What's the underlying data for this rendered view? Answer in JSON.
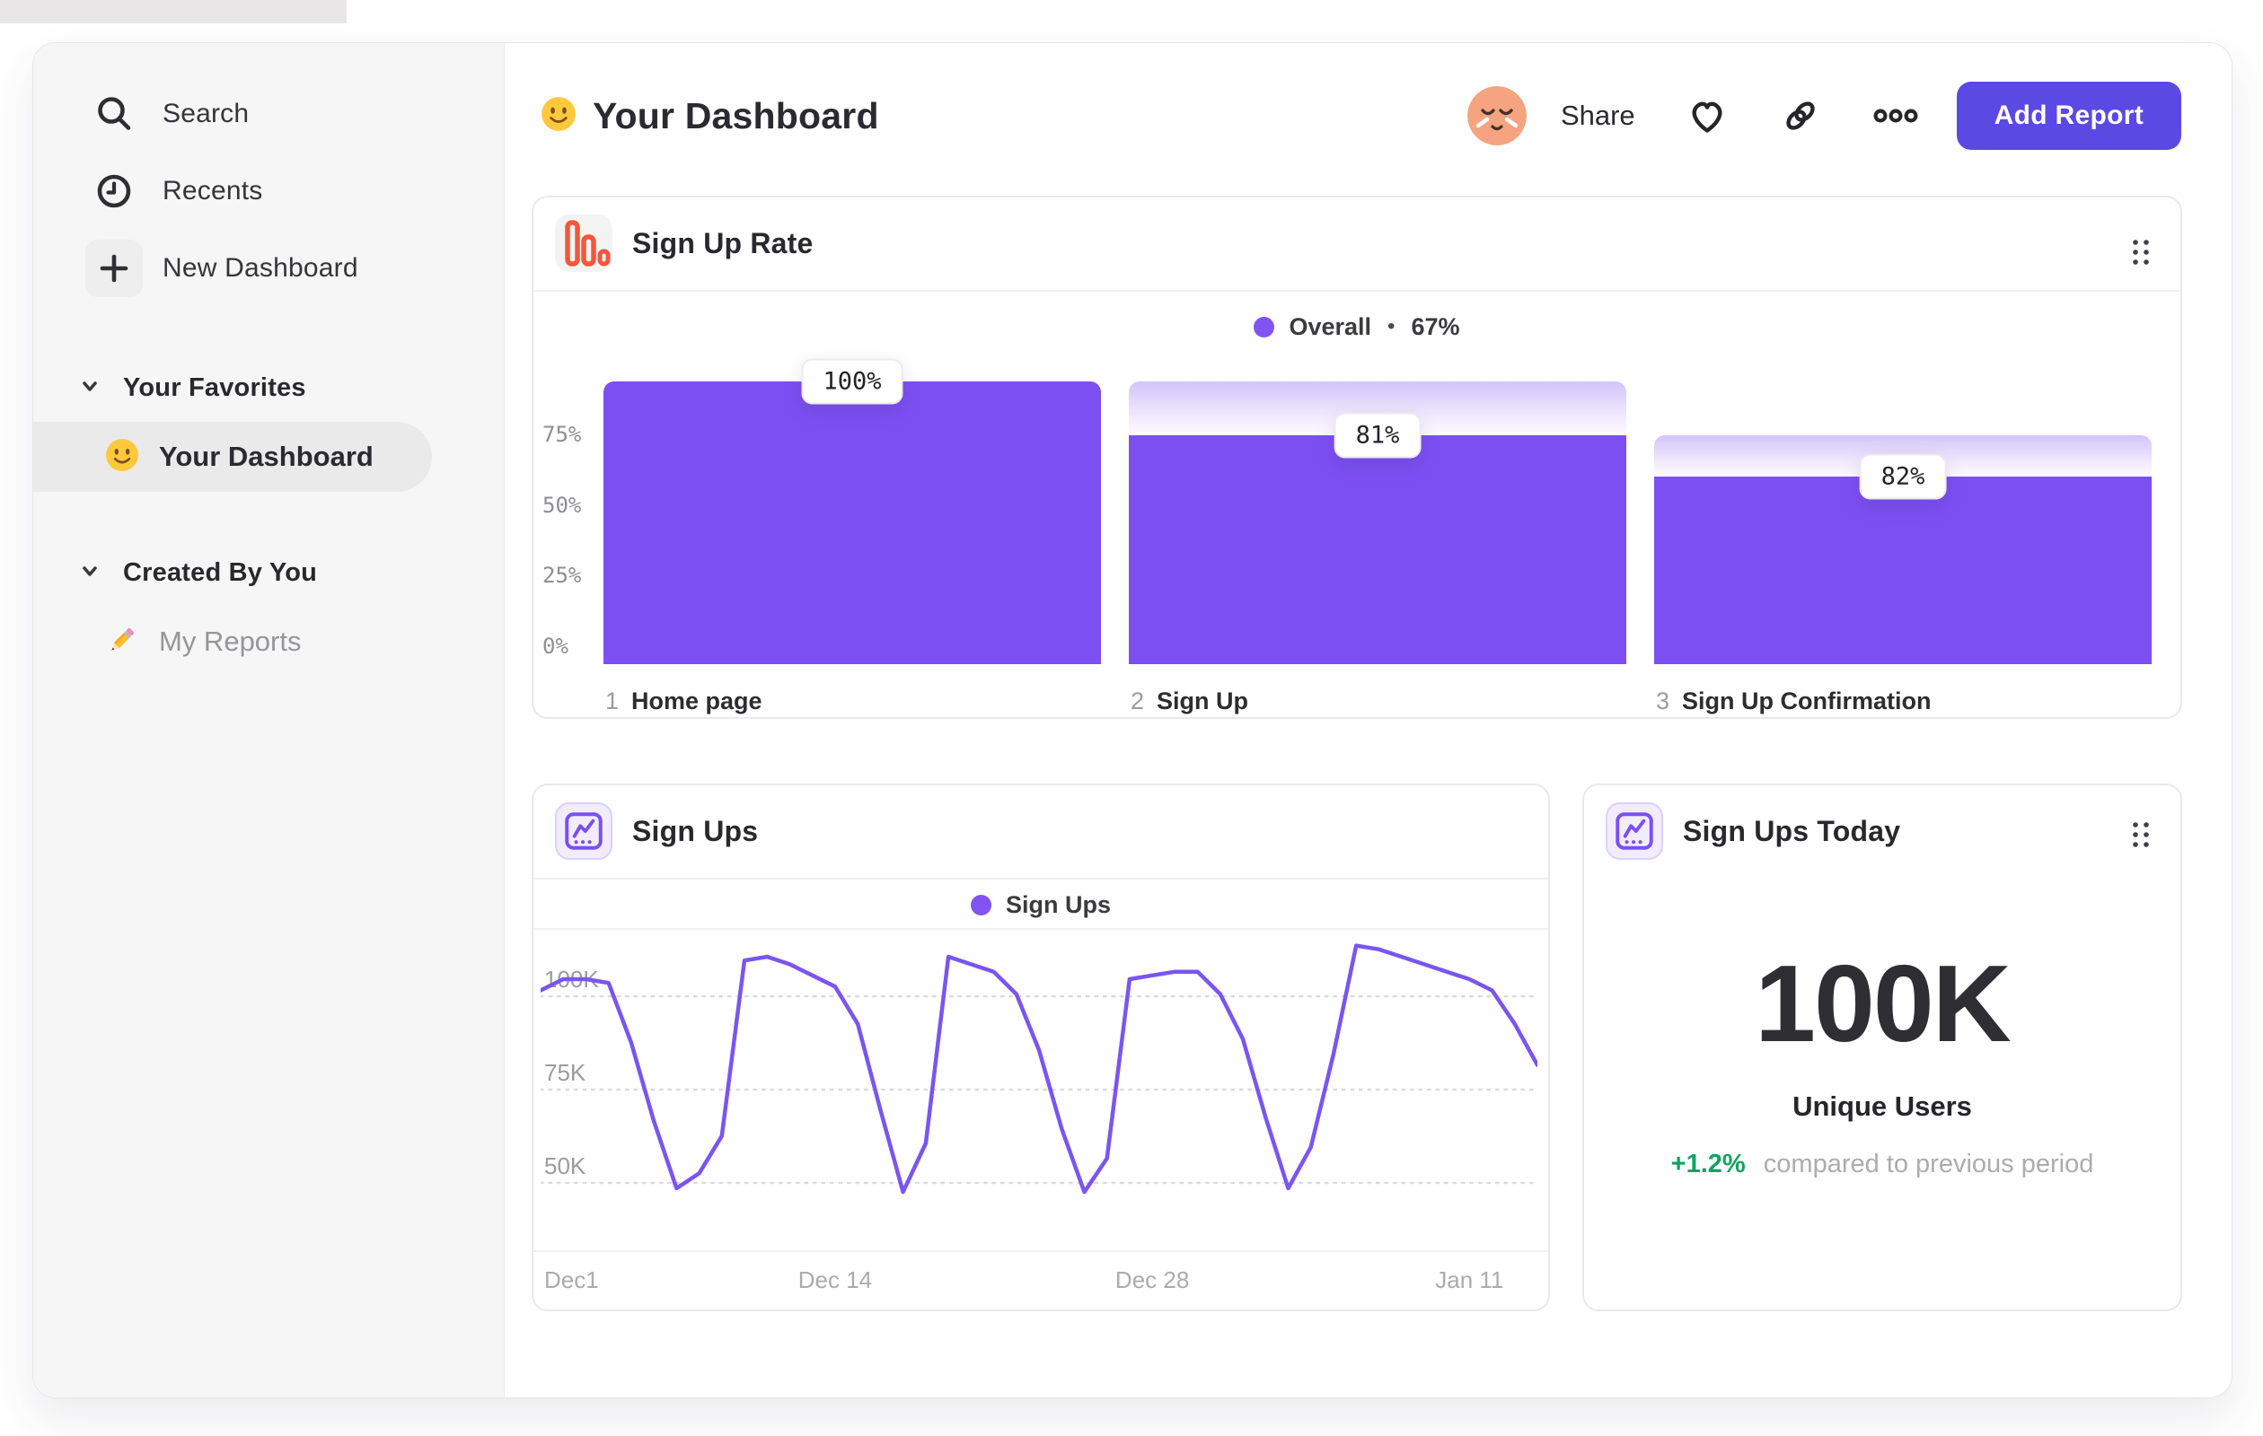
{
  "header": {
    "title": "Your Dashboard",
    "title_emoji": "smiley",
    "share_label": "Share",
    "add_report_label": "Add Report"
  },
  "sidebar": {
    "nav": [
      {
        "icon": "search-icon",
        "label": "Search"
      },
      {
        "icon": "clock-icon",
        "label": "Recents"
      },
      {
        "icon": "plus-icon",
        "label": "New Dashboard",
        "boxed": true
      }
    ],
    "sections": [
      {
        "title": "Your Favorites",
        "items": [
          {
            "emoji": "smiley",
            "label": "Your Dashboard",
            "selected": true
          }
        ]
      },
      {
        "title": "Created By You",
        "items": [
          {
            "emoji": "pencil",
            "label": "My Reports",
            "muted": true
          }
        ]
      }
    ]
  },
  "colors": {
    "bar_purple": "#7C4FF3",
    "line_purple": "#7A55F0",
    "legend_dot": "#8152F4",
    "button_indigo": "#5A49E3",
    "funnel_icon_orange": "#F2573D",
    "delta_green": "#0FA35F"
  },
  "chart_data": [
    {
      "type": "bar",
      "variant": "funnel",
      "title": "Sign Up Rate",
      "legend": {
        "label": "Overall",
        "separator": "•",
        "value": "67%"
      },
      "ylim": [
        0,
        100
      ],
      "grid": false,
      "legend_position": "top-center",
      "y_ticks": [
        {
          "label": "75%",
          "value": 75
        },
        {
          "label": "50%",
          "value": 50
        },
        {
          "label": "25%",
          "value": 25
        },
        {
          "label": "0%",
          "value": 0
        }
      ],
      "steps": [
        {
          "num": "1",
          "label": "Home page",
          "conversion_pct": 100,
          "tooltip": "100%"
        },
        {
          "num": "2",
          "label": "Sign Up",
          "conversion_pct": 81,
          "tooltip": "81%"
        },
        {
          "num": "3",
          "label": "Sign Up Confirmation",
          "conversion_pct": 82,
          "tooltip": "82%"
        }
      ],
      "cumulative_pct": [
        100,
        81,
        66.4
      ]
    },
    {
      "type": "line",
      "title": "Sign Ups",
      "legend": {
        "label": "Sign Ups"
      },
      "unit": "K",
      "ylim": [
        30,
        115
      ],
      "grid": "dotted-horizontal",
      "legend_position": "top-center",
      "y_ticks": [
        {
          "label": "100K",
          "value": 100
        },
        {
          "label": "75K",
          "value": 75
        },
        {
          "label": "50K",
          "value": 50
        }
      ],
      "x_ticks": [
        {
          "label": "Dec1",
          "index": 0
        },
        {
          "label": "Dec 14",
          "index": 13
        },
        {
          "label": "Dec 28",
          "index": 27
        },
        {
          "label": "Jan 11",
          "index": 41
        }
      ],
      "values": [
        97,
        100,
        100,
        99,
        83,
        62,
        44,
        48,
        58,
        105,
        106,
        104,
        101,
        98,
        88,
        65,
        43,
        56,
        106,
        104,
        102,
        96,
        81,
        60,
        43,
        52,
        100,
        101,
        102,
        102,
        96,
        84,
        63,
        44,
        55,
        80,
        109,
        108,
        106,
        104,
        102,
        100,
        97,
        88,
        77
      ]
    },
    {
      "type": "single_value",
      "title": "Sign Ups Today",
      "value": "100K",
      "metric_label": "Unique Users",
      "delta": "+1.2%",
      "delta_direction": "up",
      "comparison_label": "compared to previous period"
    }
  ]
}
